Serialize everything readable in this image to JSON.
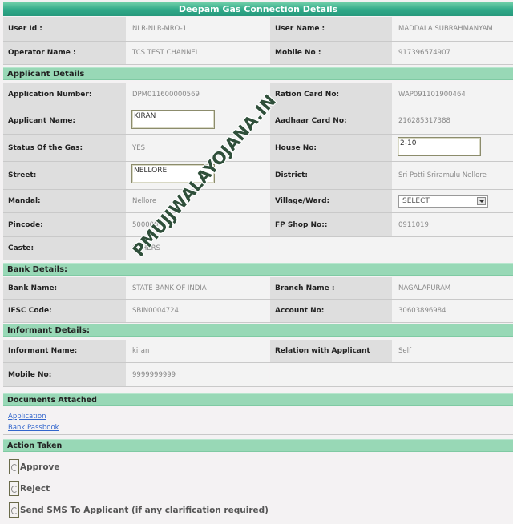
{
  "title": "Deepam Gas Connection Details",
  "top_rows": [
    {
      "l1": "User Id :",
      "v1": "NLR-NLR-MRO-1",
      "l2": "User Name :",
      "v2": "MADDALA SUBRAHMANYAM"
    },
    {
      "l1": "Operator Name :",
      "v1": "TCS TEST CHANNEL",
      "l2": "Mobile No :",
      "v2": "917396574907"
    }
  ],
  "applicant": {
    "header": "Applicant Details",
    "application_number_label": "Application Number:",
    "application_number": "DPM011600000569",
    "ration_card_label": "Ration Card No:",
    "ration_card": "WAP091101900464",
    "applicant_name_label": "Applicant Name:",
    "applicant_name": "KIRAN",
    "aadhaar_label": "Aadhaar Card No:",
    "aadhaar": "216285317388",
    "status_gas_label": "Status Of the Gas:",
    "status_gas": "YES",
    "house_no_label": "House No:",
    "house_no": "2-10",
    "street_label": "Street:",
    "street": "NELLORE",
    "district_label": "District:",
    "district": "Sri Potti Sriramulu Nellore",
    "mandal_label": "Mandal:",
    "mandal": "Nellore",
    "village_label": "Village/Ward:",
    "village_selected": "SELECT",
    "pincode_label": "Pincode:",
    "pincode": "500000",
    "fp_shop_label": "FP Shop No::",
    "fp_shop": "0911019",
    "caste_label": "Caste:",
    "caste": "OTHERS"
  },
  "bank": {
    "header": "Bank Details:",
    "bank_name_label": "Bank Name:",
    "bank_name": "STATE BANK OF INDIA",
    "branch_label": "Branch Name :",
    "branch": "NAGALAPURAM",
    "ifsc_label": "IFSC Code:",
    "ifsc": "SBIN0004724",
    "account_label": "Account No:",
    "account": "30603896984"
  },
  "informant": {
    "header": "Informant Details:",
    "name_label": "Informant Name:",
    "name": "kiran",
    "relation_label": "Relation with Applicant",
    "relation": "Self",
    "mobile_label": "Mobile No:",
    "mobile": "9999999999"
  },
  "documents": {
    "header": "Documents Attached",
    "links": [
      "Application",
      "Bank Passbook"
    ]
  },
  "action": {
    "header": "Action Taken",
    "options": [
      "Approve",
      "Reject",
      "Send SMS To Applicant (if any clarification required)"
    ]
  },
  "watermark": "PMUJJWALAYOJANA.IN",
  "colors": {
    "title_bar": "#2fa888",
    "section_header": "#98d8b6",
    "label_bg": "#dedede",
    "value_bg": "#f3f3f3",
    "link": "#3366cc"
  }
}
